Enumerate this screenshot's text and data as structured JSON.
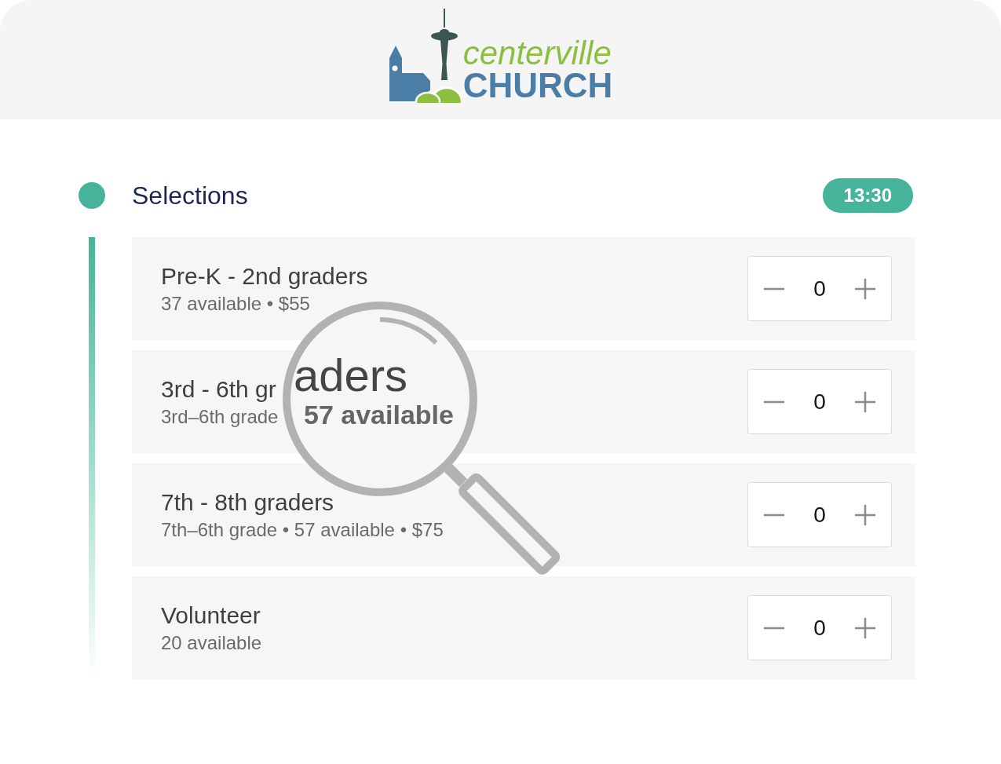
{
  "header": {
    "logo": {
      "line_1": "centerville",
      "line_2": "CHURCH"
    }
  },
  "section": {
    "title": "Selections",
    "timer": "13:30"
  },
  "options": [
    {
      "name": "Pre-K - 2nd graders",
      "details": "37 available • $55",
      "quantity": "0"
    },
    {
      "name": "3rd - 6th gr",
      "details": "3rd–6th grade",
      "quantity": "0"
    },
    {
      "name": "7th - 8th graders",
      "details": "7th–6th grade • 57 available • $75",
      "quantity": "0"
    },
    {
      "name": "Volunteer",
      "details": "20 available",
      "quantity": "0"
    }
  ],
  "magnifier": {
    "lines": [
      "aders",
      "57 available"
    ]
  }
}
